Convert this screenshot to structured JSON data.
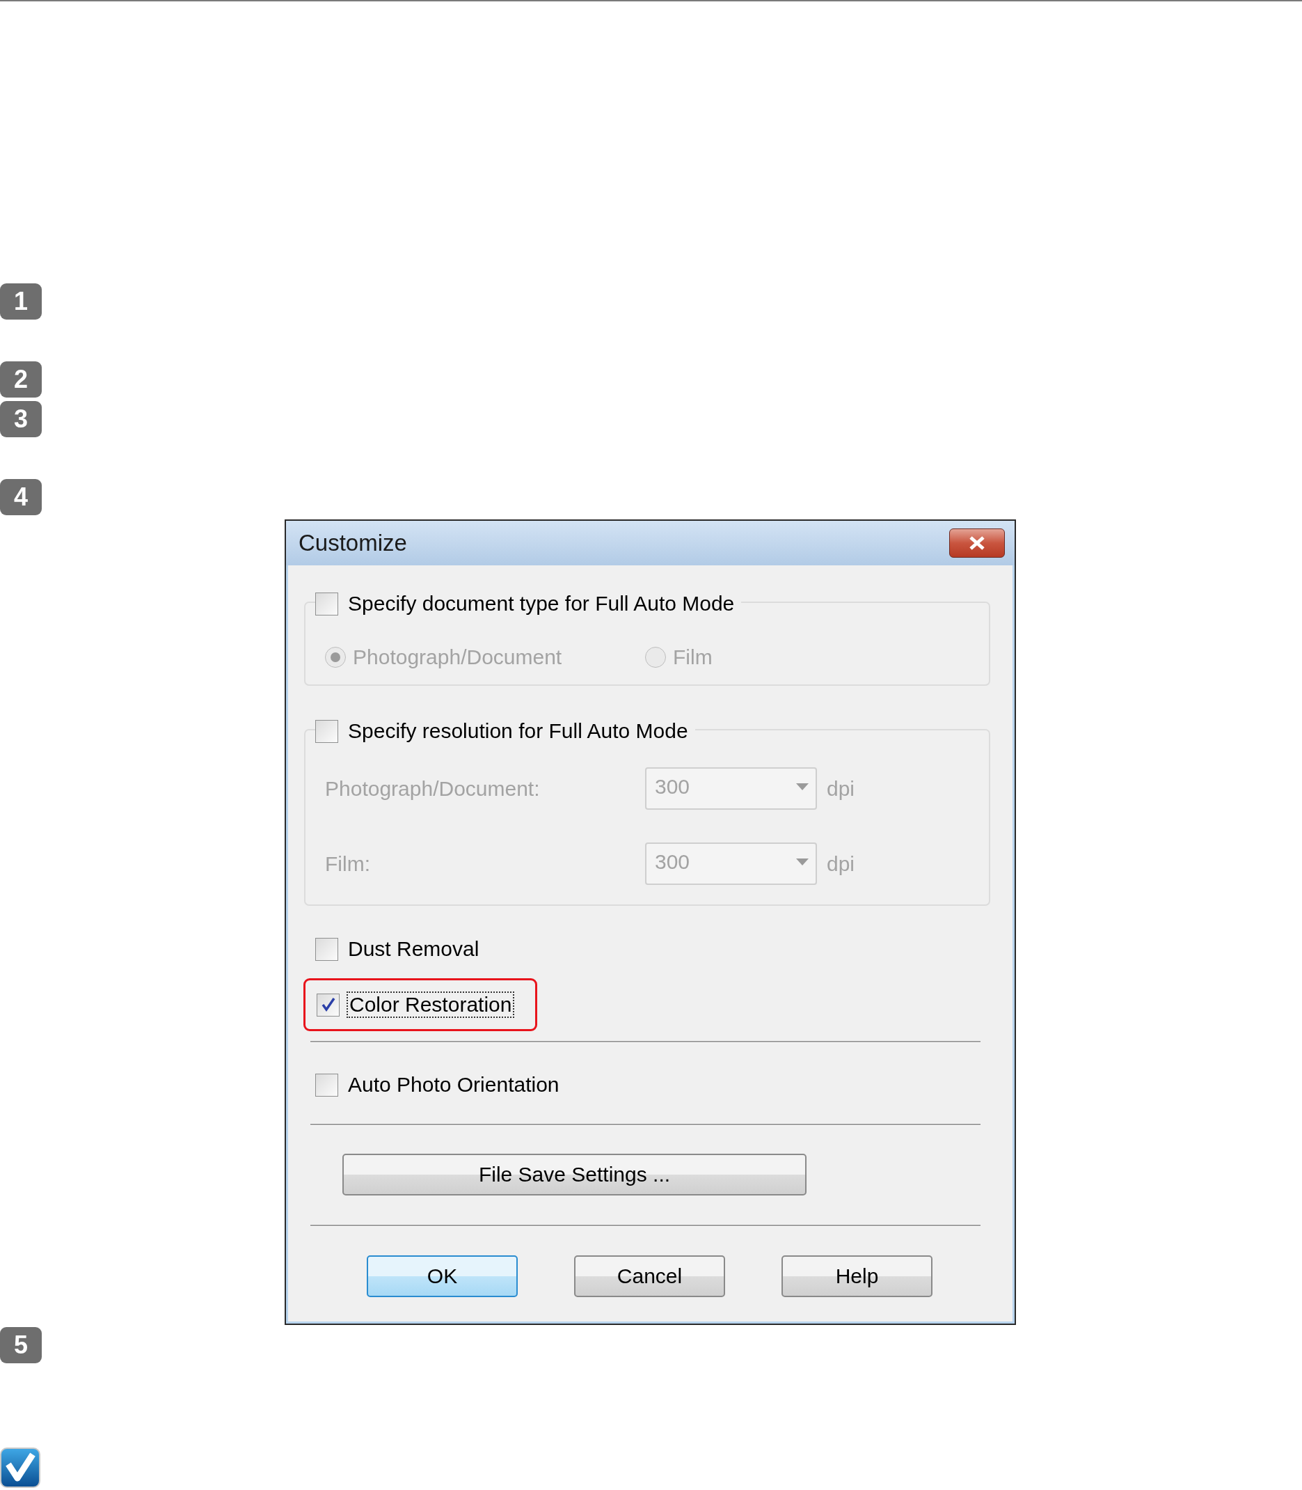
{
  "steps": [
    {
      "label": "1"
    },
    {
      "label": "2"
    },
    {
      "label": "3"
    },
    {
      "label": "4"
    },
    {
      "label": "5"
    }
  ],
  "dialog": {
    "title": "Customize",
    "groups": [
      {
        "kind": "radio",
        "label": "Specify document type for Full Auto Mode",
        "checked": false,
        "options": [
          {
            "label": "Photograph/Document",
            "selected": true
          },
          {
            "label": "Film",
            "selected": false
          }
        ]
      },
      {
        "kind": "combo",
        "label": "Specify resolution for Full Auto Mode",
        "checked": false,
        "fields": [
          {
            "label": "Photograph/Document:",
            "value": "300",
            "unit": "dpi"
          },
          {
            "label": "Film:",
            "value": "300",
            "unit": "dpi"
          }
        ]
      }
    ],
    "checks": [
      {
        "label": "Dust Removal",
        "checked": false,
        "focused": false,
        "highlighted": false
      },
      {
        "label": "Color Restoration",
        "checked": true,
        "focused": true,
        "highlighted": true
      }
    ],
    "orientation_check": {
      "label": "Auto Photo Orientation",
      "checked": false
    },
    "file_save_button": "File Save Settings ...",
    "buttons": [
      {
        "label": "OK",
        "default": true
      },
      {
        "label": "Cancel",
        "default": false
      },
      {
        "label": "Help",
        "default": false
      }
    ]
  }
}
